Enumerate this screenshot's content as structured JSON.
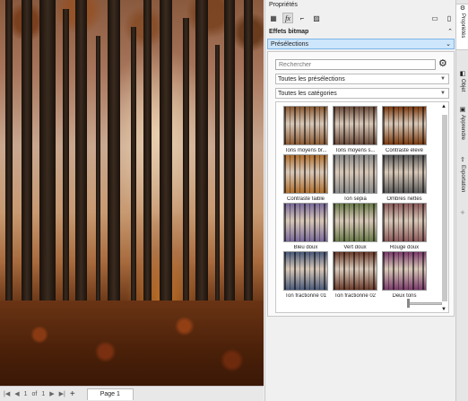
{
  "status_bar": {
    "first": "|◀",
    "prev": "◀",
    "page_current": "1",
    "page_of": "of",
    "page_total": "1",
    "next": "▶",
    "last": "▶|",
    "add": "+",
    "page_tab": "Page 1"
  },
  "docker": {
    "title": "Propriétés",
    "toolbar_icons": [
      "checker-icon",
      "fx-icon",
      "crop-icon",
      "bitmap-icon",
      "frame-icon",
      "document-icon"
    ],
    "section_title": "Effets bitmap",
    "presets_label": "Présélections",
    "search_placeholder": "Rechercher",
    "filter_presets": "Toutes les présélections",
    "filter_categories": "Toutes les catégories",
    "presets": [
      {
        "label": "Tons moyens br...",
        "color": "#8a5a34"
      },
      {
        "label": "Tons moyens s...",
        "color": "#6a4a3a"
      },
      {
        "label": "Contraste élevé",
        "color": "#7a3a10"
      },
      {
        "label": "Contraste faible",
        "color": "#b07030"
      },
      {
        "label": "Ton sépia",
        "color": "#8a8a8a"
      },
      {
        "label": "Ombres nettes",
        "color": "#5a5a5a"
      },
      {
        "label": "Bleu doux",
        "color": "#7a6a9a"
      },
      {
        "label": "Vert doux",
        "color": "#6a7a4a"
      },
      {
        "label": "Rouge doux",
        "color": "#8a5a5a"
      },
      {
        "label": "Ton fractionné 01",
        "color": "#4a5a7a"
      },
      {
        "label": "Ton fractionné 02",
        "color": "#6a3a2a"
      },
      {
        "label": "Deux tons",
        "color": "#7a3a6a"
      }
    ]
  },
  "side_tabs": [
    {
      "label": "Propriétés",
      "icon": "properties-icon"
    },
    {
      "label": "Objet",
      "icon": "object-icon"
    },
    {
      "label": "Apprendre",
      "icon": "learn-icon"
    },
    {
      "label": "Exportation",
      "icon": "export-icon"
    },
    {
      "label": "+",
      "icon": "add-icon"
    }
  ]
}
